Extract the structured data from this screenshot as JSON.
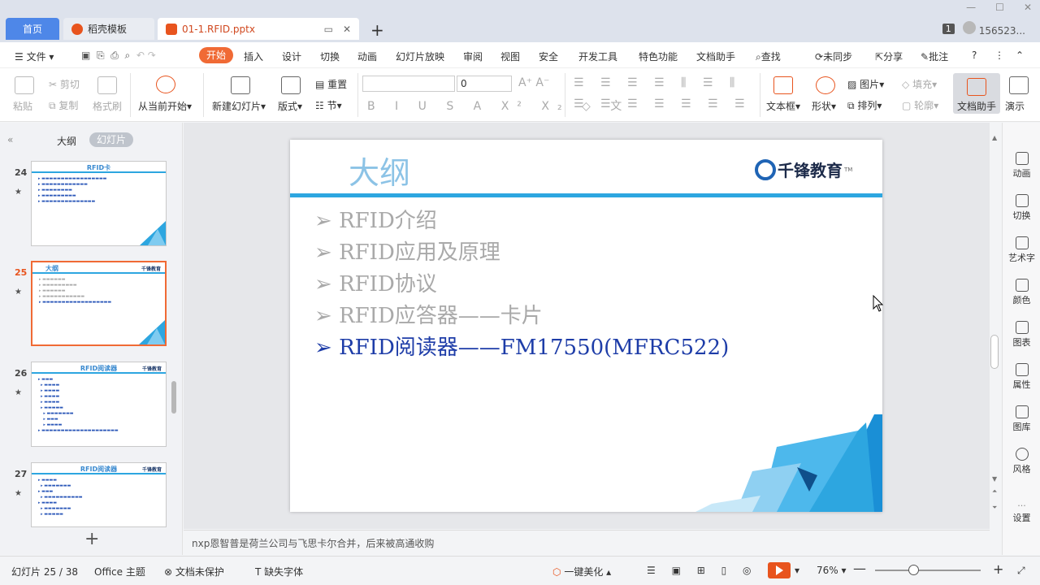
{
  "tabs": {
    "home": "首页",
    "template": "稻壳模板",
    "file": "01-1.RFID.pptx",
    "page_badge": "1",
    "user_id": "156523..."
  },
  "menu": {
    "file": "文件",
    "start": "开始",
    "insert": "插入",
    "design": "设计",
    "transition": "切换",
    "animation": "动画",
    "slideshow": "幻灯片放映",
    "review": "审阅",
    "view": "视图",
    "security": "安全",
    "devtools": "开发工具",
    "features": "特色功能",
    "docassist": "文档助手",
    "search": "查找",
    "sync": "未同步",
    "share": "分享",
    "annotate": "批注"
  },
  "ribbon": {
    "paste": "粘贴",
    "cut": "剪切",
    "copy": "复制",
    "format_painter": "格式刷",
    "from_current": "从当前开始",
    "new_slide": "新建幻灯片",
    "layout": "版式",
    "reset": "重置",
    "section": "节",
    "font_size": "0",
    "textbox": "文本框",
    "shape": "形状",
    "picture": "图片",
    "arrange": "排列",
    "fill": "填充",
    "outline": "轮廓",
    "doc_assistant": "文档助手",
    "present": "演示"
  },
  "leftpanel": {
    "outline_tab": "大纲",
    "slides_tab": "幻灯片",
    "thumbs": [
      {
        "num": "24",
        "title": "RFID卡"
      },
      {
        "num": "25",
        "title": "大纲"
      },
      {
        "num": "26",
        "title": "RFID阅读器"
      },
      {
        "num": "27",
        "title": "RFID阅读器"
      }
    ]
  },
  "slide": {
    "title": "大纲",
    "logo": "千锋教育",
    "logo_tm": "TM",
    "bullets": [
      "RFID介绍",
      "RFID应用及原理",
      "RFID协议",
      "RFID应答器——卡片",
      "RFID阅读器——FM17550(MFRC522)"
    ],
    "current_bullet": 4
  },
  "notes": "nxp恩智普是荷兰公司与飞思卡尔合并，后来被高通收购",
  "rightpanel": [
    "动画",
    "切换",
    "艺术字",
    "颜色",
    "图表",
    "属性",
    "图库",
    "风格",
    "设置"
  ],
  "status": {
    "slide_info": "幻灯片 25 / 38",
    "theme": "Office 主题",
    "protect": "文档未保护",
    "missing_font": "缺失字体",
    "beautify": "一键美化",
    "zoom": "76%"
  },
  "colors": {
    "accent": "#f06a35",
    "title_bar": "#2da6e0",
    "current_bullet": "#1e3da8"
  }
}
